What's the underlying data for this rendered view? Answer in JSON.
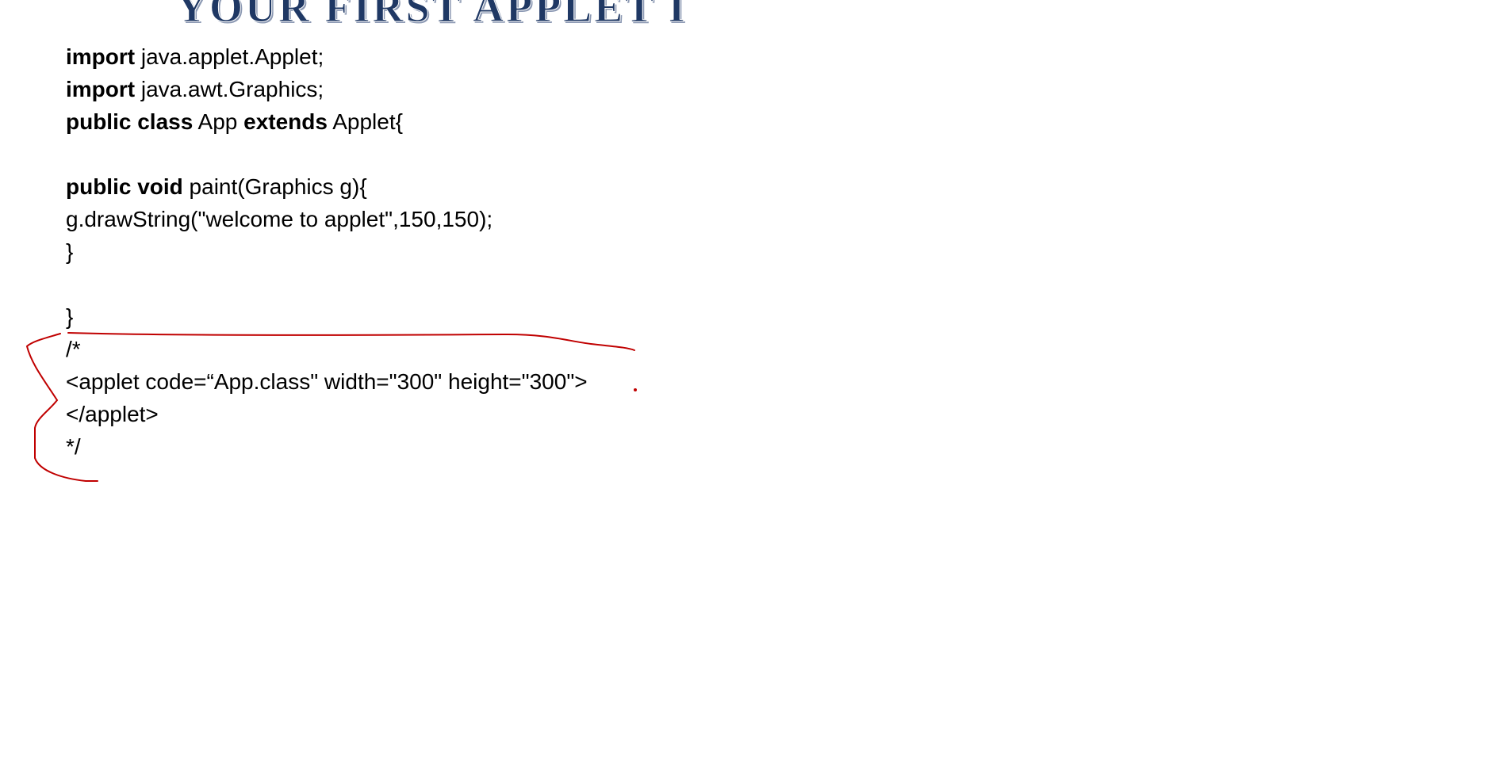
{
  "title": "YOUR FIRST APPLET I",
  "code_lines": [
    [
      {
        "t": "import",
        "b": true
      },
      {
        "t": " java.applet.Applet;",
        "b": false
      }
    ],
    [
      {
        "t": "import",
        "b": true
      },
      {
        "t": " java.awt.Graphics;",
        "b": false
      }
    ],
    [
      {
        "t": "public class",
        "b": true
      },
      {
        "t": " App ",
        "b": false
      },
      {
        "t": "extends",
        "b": true
      },
      {
        "t": " Applet{",
        "b": false
      }
    ],
    [],
    [
      {
        "t": "public void",
        "b": true
      },
      {
        "t": " paint(Graphics g){",
        "b": false
      }
    ],
    [
      {
        "t": "g.drawString(\"welcome to applet\",150,150);",
        "b": false
      }
    ],
    [
      {
        "t": "}",
        "b": false
      }
    ],
    [],
    [
      {
        "t": "}",
        "b": false
      }
    ],
    [
      {
        "t": "/*",
        "b": false
      }
    ],
    [
      {
        "t": "<applet code=“App.class\" width=\"300\" height=\"300\">",
        "b": false
      }
    ],
    [
      {
        "t": "</applet>",
        "b": false
      }
    ],
    [
      {
        "t": "*/",
        "b": false
      }
    ]
  ],
  "colors": {
    "title": "#1f3864",
    "ink_annotation": "#c00000",
    "text": "#000000"
  }
}
